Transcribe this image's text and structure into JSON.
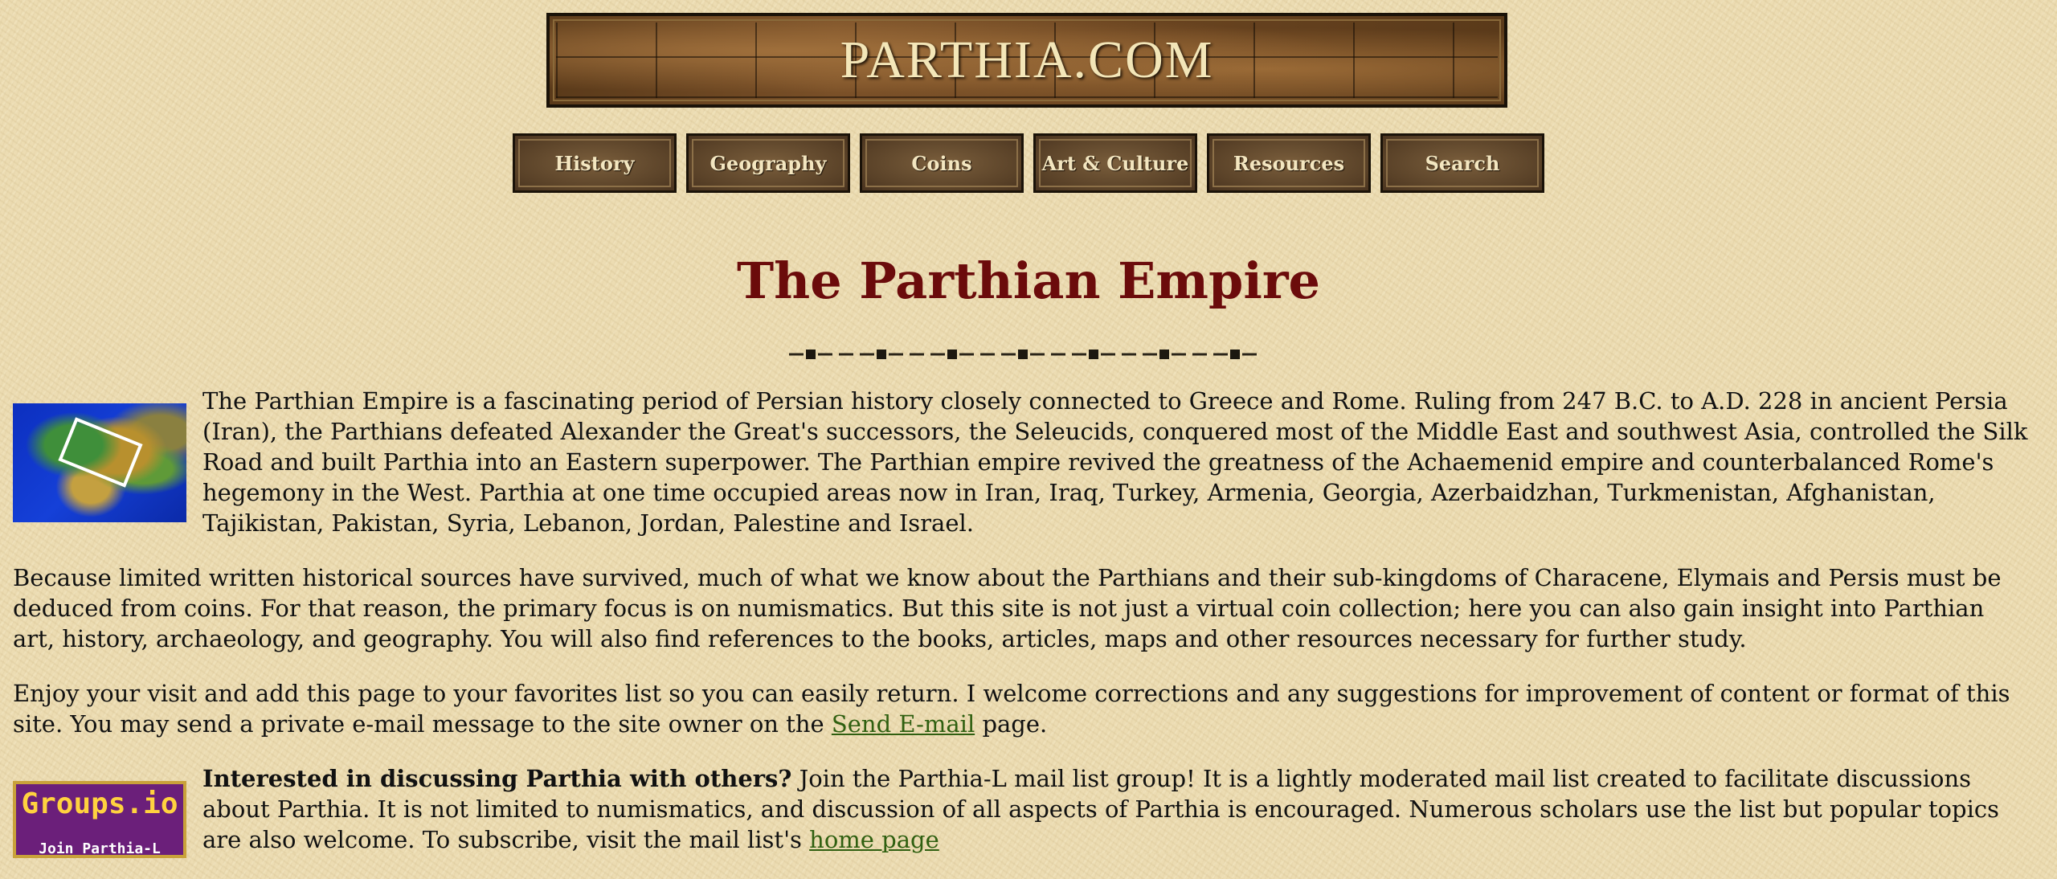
{
  "site": {
    "title": "PARTHIA.COM"
  },
  "nav": {
    "items": [
      {
        "label": "History"
      },
      {
        "label": "Geography"
      },
      {
        "label": "Coins"
      },
      {
        "label": "Art & Culture"
      },
      {
        "label": "Resources"
      },
      {
        "label": "Search"
      }
    ]
  },
  "page": {
    "title": "The Parthian Empire",
    "intro": "The Parthian Empire is a fascinating period of Persian history closely connected to Greece and Rome. Ruling from 247 B.C. to A.D. 228 in ancient Persia (Iran), the Parthians defeated Alexander the Great's successors, the Seleucids, conquered most of the Middle East and southwest Asia, controlled the Silk Road and built Parthia into an Eastern superpower. The Parthian empire revived the greatness of the Achaemenid empire and counterbalanced Rome's hegemony in the West. Parthia at one time occupied areas now in Iran, Iraq, Turkey, Armenia, Georgia, Azerbaidzhan, Turkmenistan, Afghanistan, Tajikistan, Pakistan, Syria, Lebanon, Jordan, Palestine and Israel.",
    "sources": "Because limited written historical sources have survived, much of what we know about the Parthians and their sub-kingdoms of Characene, Elymais and Persis must be deduced from coins. For that reason, the primary focus is on numismatics. But this site is not just a virtual coin collection; here you can also gain insight into Parthian art, history, archaeology, and geography. You will also find references to the books, articles, maps and other resources necessary for further study.",
    "enjoy_before": "Enjoy your visit and add this page to your favorites list so you can easily return. I welcome corrections and any suggestions for improvement of content or format of this site. You may send a private e-mail message to the site owner on the ",
    "enjoy_link": "Send E-mail",
    "enjoy_after": " page.",
    "discuss_bold": "Interested in discussing Parthia with others?",
    "discuss_text": " Join the Parthia-L mail list group! It is a lightly moderated mail list created to facilitate discussions about Parthia. It is not limited to numismatics, and discussion of all aspects of Parthia is encouraged. Numerous scholars use the list but popular topics are also welcome. To subscribe, visit the mail list's ",
    "discuss_link": "home page",
    "groups_logo": "Groups.io",
    "groups_sub": "Join Parthia-L"
  }
}
